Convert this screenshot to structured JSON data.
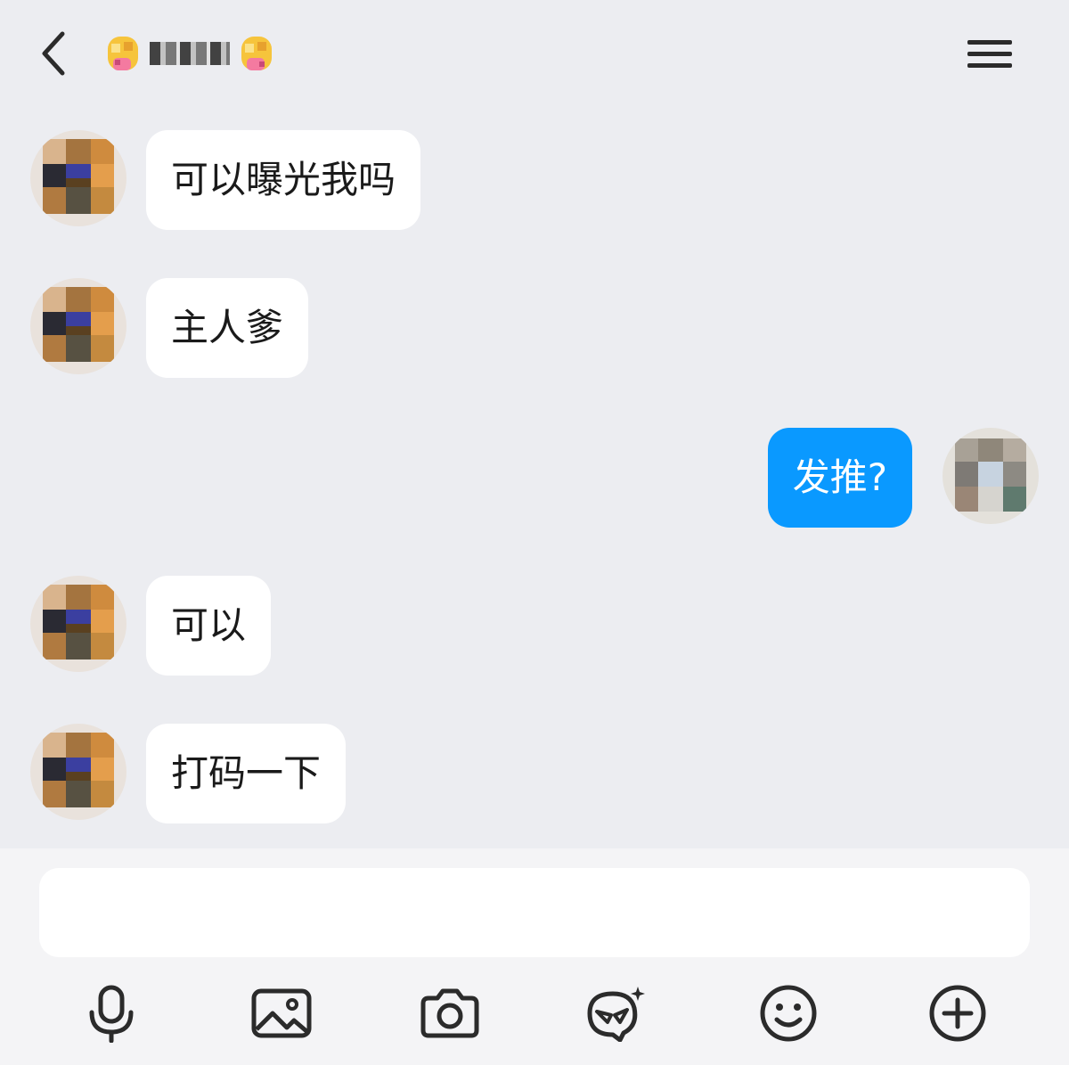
{
  "header": {
    "title": "",
    "back_icon": "chevron-left-icon",
    "menu_icon": "menu-icon",
    "title_emoji": "tongue-emoji"
  },
  "messages": [
    {
      "side": "left",
      "text": "可以曝光我吗",
      "avatar": "contact-avatar"
    },
    {
      "side": "left",
      "text": "主人爹",
      "avatar": "contact-avatar"
    },
    {
      "side": "right",
      "text": "发推?",
      "avatar": "self-avatar"
    },
    {
      "side": "left",
      "text": "可以",
      "avatar": "contact-avatar"
    },
    {
      "side": "left",
      "text": "打码一下",
      "avatar": "contact-avatar"
    }
  ],
  "composer": {
    "value": "",
    "placeholder": ""
  },
  "toolbar": [
    {
      "icon": "microphone-icon"
    },
    {
      "icon": "image-icon"
    },
    {
      "icon": "camera-icon"
    },
    {
      "icon": "sticker-icon"
    },
    {
      "icon": "emoji-icon"
    },
    {
      "icon": "plus-circle-icon"
    }
  ],
  "colors": {
    "background": "#ecedf1",
    "bubble_incoming": "#ffffff",
    "bubble_outgoing": "#0a99ff",
    "text_dark": "#1a1a1a",
    "icon": "#2b2b2b"
  }
}
